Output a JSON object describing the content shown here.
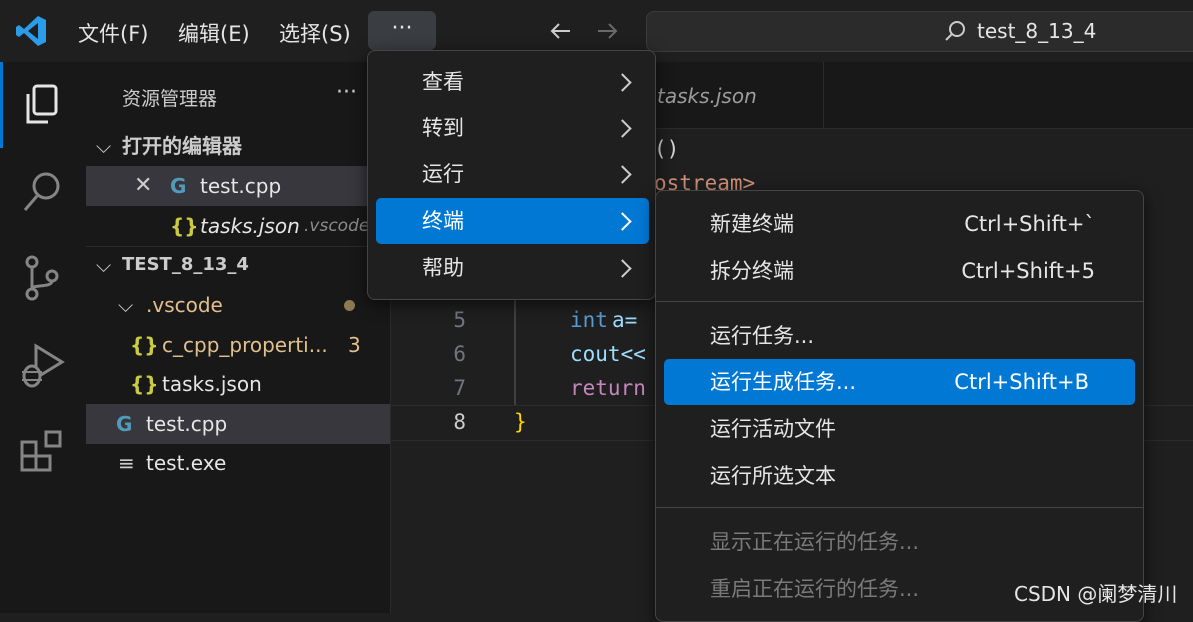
{
  "menubar": {
    "file": "文件(F)",
    "edit": "编辑(E)",
    "select": "选择(S)",
    "more": "···"
  },
  "search": {
    "text": "test_8_13_4"
  },
  "sidebar": {
    "title": "资源管理器",
    "more": "···",
    "open_editors": "打开的编辑器",
    "open_files": [
      {
        "name": "test.cpp",
        "dir": ""
      },
      {
        "name": "tasks.json",
        "dir": ".vscode"
      }
    ],
    "project": "TEST_8_13_4",
    "tree": [
      {
        "name": ".vscode"
      },
      {
        "name": "c_cpp_properti...",
        "badge": "3"
      },
      {
        "name": "tasks.json"
      },
      {
        "name": "test.cpp"
      },
      {
        "name": "test.exe"
      }
    ]
  },
  "editor": {
    "tab": "tasks.json",
    "frag1": "()",
    "frag2": "ostream>",
    "lines": [
      {
        "no": "5",
        "kw": "int",
        "rest": " a="
      },
      {
        "no": "6",
        "kw": "cout<<",
        "rest": ""
      },
      {
        "no": "7",
        "kw": "return",
        "rest": ""
      },
      {
        "no": "8",
        "kw": "}",
        "rest": ""
      }
    ]
  },
  "more_menu": {
    "items": [
      "查看",
      "转到",
      "运行",
      "终端",
      "帮助"
    ]
  },
  "terminal_menu": {
    "items": [
      {
        "label": "新建终端",
        "shortcut": "Ctrl+Shift+`"
      },
      {
        "label": "拆分终端",
        "shortcut": "Ctrl+Shift+5"
      },
      {
        "label": "运行任务...",
        "shortcut": ""
      },
      {
        "label": "运行生成任务...",
        "shortcut": "Ctrl+Shift+B"
      },
      {
        "label": "运行活动文件",
        "shortcut": ""
      },
      {
        "label": "运行所选文本",
        "shortcut": ""
      },
      {
        "label": "显示正在运行的任务...",
        "shortcut": ""
      },
      {
        "label": "重启正在运行的任务...",
        "shortcut": ""
      }
    ]
  },
  "watermark": "CSDN @阑梦清川",
  "colors": {
    "accent": "#0078d4",
    "modified": "#e2c08d",
    "keyword": "#569cd6",
    "return": "#c586c0",
    "string": "#ce9178"
  }
}
